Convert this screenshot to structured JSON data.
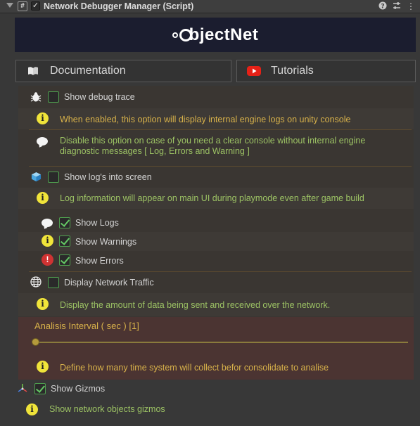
{
  "header": {
    "title": "Network Debugger Manager (Script)",
    "script_icon_glyph": "#",
    "icons": [
      "help-icon",
      "presets-icon",
      "more-icon"
    ]
  },
  "logo": {
    "text": "bjectNet"
  },
  "buttons": {
    "documentation": "Documentation",
    "tutorials": "Tutorials"
  },
  "debug_trace": {
    "label": "Show debug trace",
    "checked": false,
    "info": "When enabled, this option will display internal engine logs on unity console",
    "note_line1": "Disable this option on case of you need a clear console without internal engine",
    "note_line2": "diagnostic messages [ Log, Errors and Warning ]"
  },
  "logs_screen": {
    "label": "Show log's into screen",
    "checked": false,
    "info": "Log information will appear on main UI during playmode even after game build",
    "options": [
      {
        "label": "Show Logs",
        "checked": true
      },
      {
        "label": "Show Warnings",
        "checked": true
      },
      {
        "label": "Show Errors",
        "checked": true
      }
    ]
  },
  "traffic": {
    "label": "Display Network Traffic",
    "checked": false,
    "info": "Display the amount of data being sent and received over the network.",
    "interval_label": "Analisis Interval ( sec ) [1]",
    "slider_value_fraction": 0.0,
    "interval_info": "Define how many time system will collect befor consolidate to analise"
  },
  "gizmos": {
    "label": "Show Gizmos",
    "checked": true,
    "info": "Show network objects gizmos"
  },
  "colors": {
    "info_text": "#d7b14a",
    "note_text": "#9cc264",
    "check_border": "#4fa04f",
    "interval_bg": "#4b3432"
  }
}
